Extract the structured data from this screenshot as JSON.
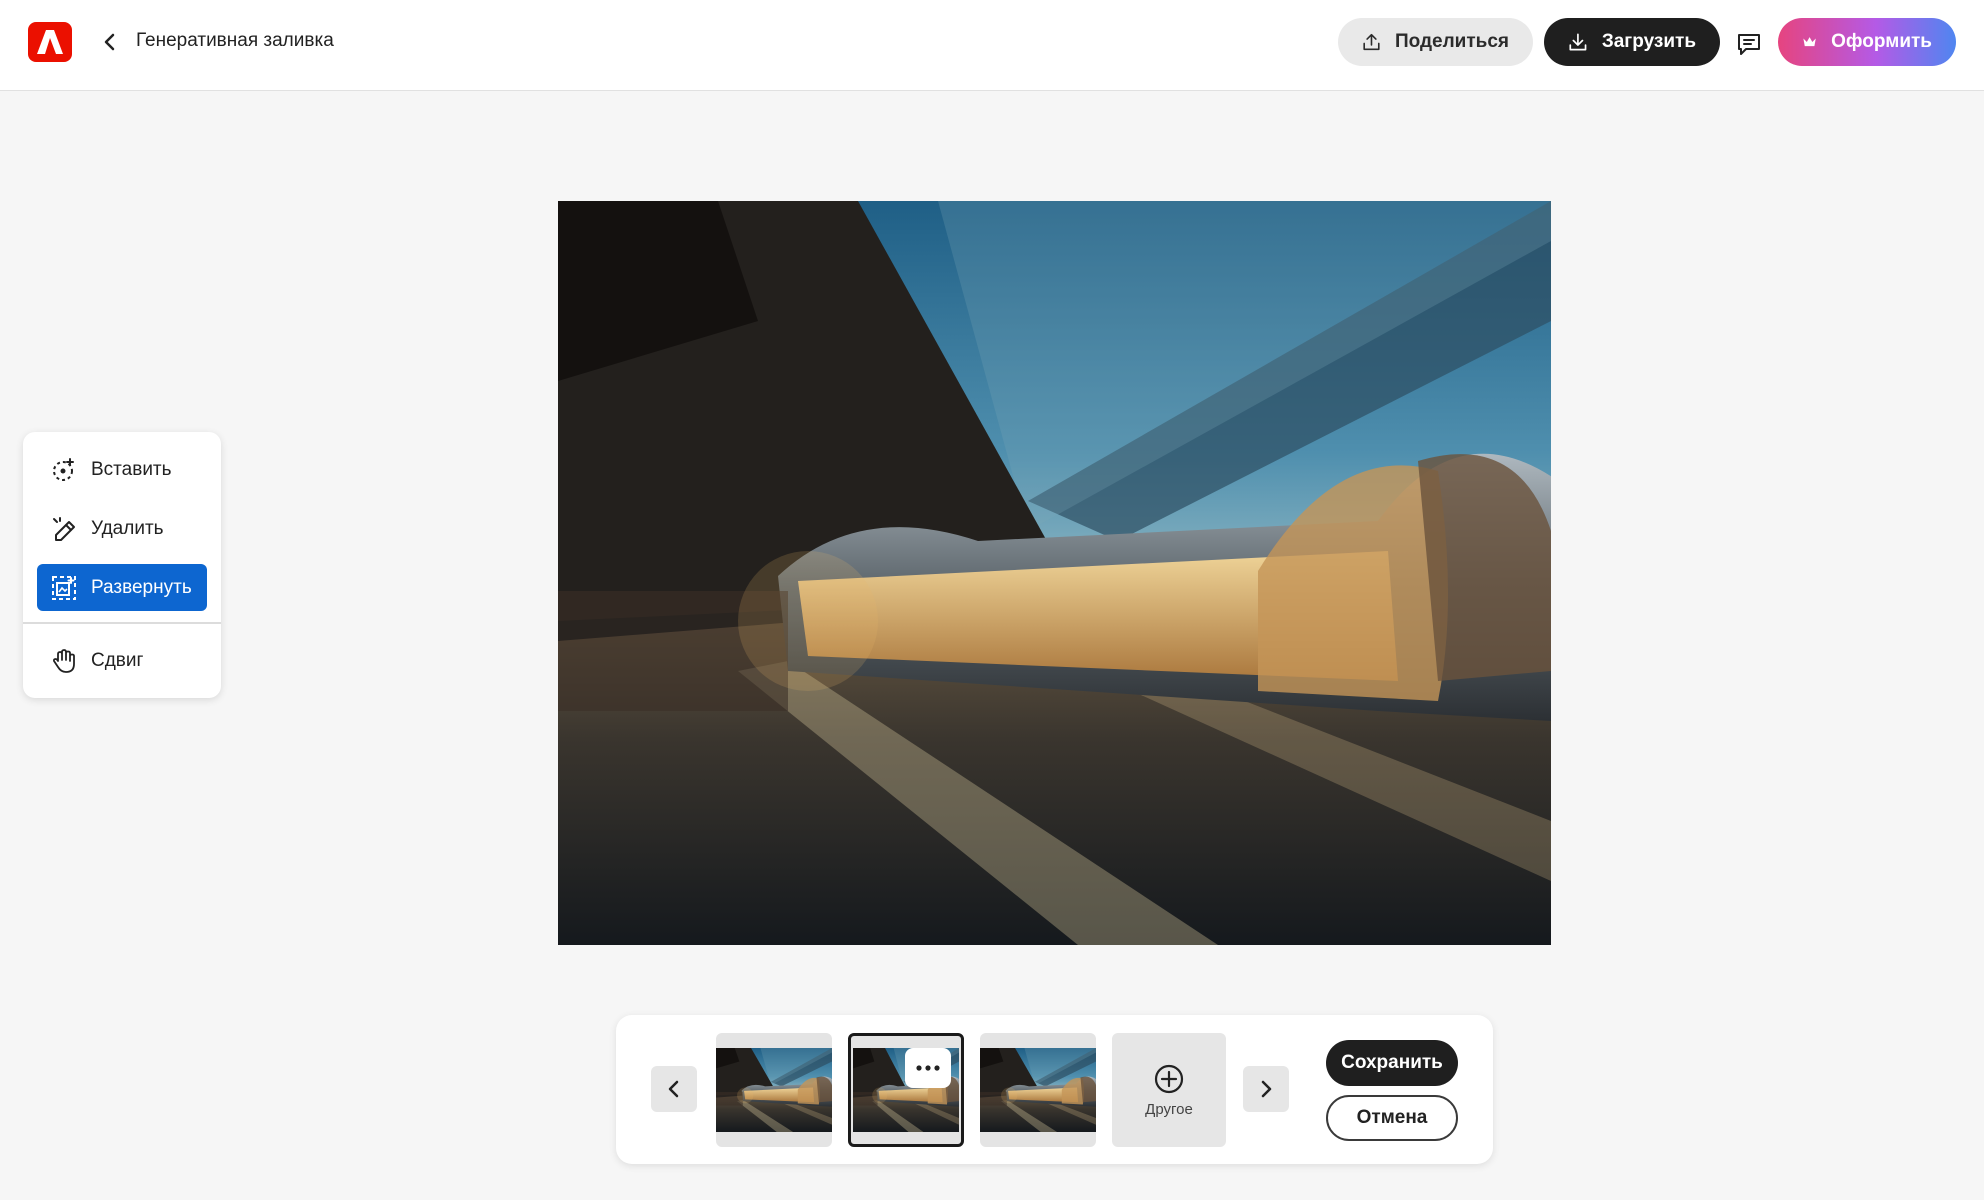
{
  "header": {
    "logo_icon": "adobe-express-logo",
    "back_icon": "chevron-left-icon",
    "title": "Генеративная заливка",
    "share_label": "Поделиться",
    "share_icon": "upload-icon",
    "download_label": "Загрузить",
    "download_icon": "download-icon",
    "comment_icon": "comment-icon",
    "premium_label": "Оформить",
    "premium_icon": "crown-icon"
  },
  "tools": {
    "items": [
      {
        "label": "Вставить",
        "icon": "insert-icon",
        "active": false
      },
      {
        "label": "Удалить",
        "icon": "remove-icon",
        "active": false
      },
      {
        "label": "Развернуть",
        "icon": "expand-icon",
        "active": true
      },
      {
        "label": "Сдвиг",
        "icon": "hand-icon",
        "active": false
      }
    ]
  },
  "variations": {
    "prev_icon": "chevron-left-icon",
    "next_icon": "chevron-right-icon",
    "more_icon": "more-horizontal-icon",
    "selected_index": 1,
    "more_label": "Другое",
    "more_tile_icon": "plus-circle-icon",
    "save_label": "Сохранить",
    "cancel_label": "Отмена"
  },
  "colors": {
    "accent": "#0d66d0",
    "brand_red": "#eb1000",
    "dark_button": "#1f1f1f"
  }
}
